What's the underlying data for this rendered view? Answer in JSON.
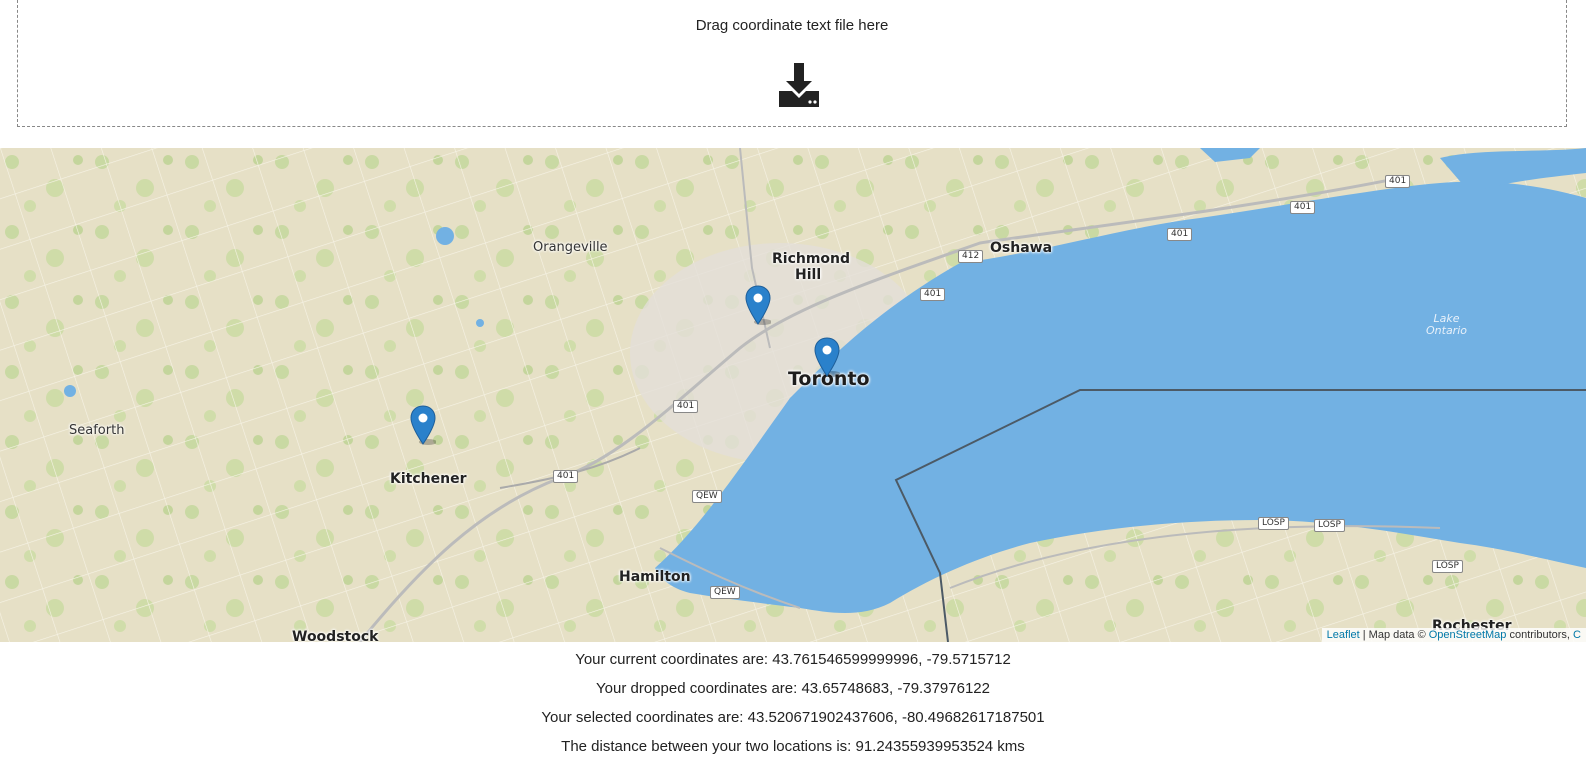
{
  "dropzone": {
    "label": "Drag coordinate text file here",
    "icon": "download-tray-icon"
  },
  "map": {
    "places": {
      "orangeville": "Orangeville",
      "richmond_hill_1": "Richmond",
      "richmond_hill_2": "Hill",
      "oshawa": "Oshawa",
      "toronto": "Toronto",
      "seaforth": "Seaforth",
      "kitchener": "Kitchener",
      "hamilton": "Hamilton",
      "woodstock": "Woodstock",
      "lake_1": "Lake",
      "lake_2": "Ontario",
      "rochester": "Rochester"
    },
    "shields": [
      "401",
      "401",
      "401",
      "412",
      "401",
      "401",
      "401",
      "QEW",
      "QEW",
      "LOSP",
      "LOSP",
      "LOSP"
    ],
    "attribution": {
      "leaflet": "Leaflet",
      "sep": " | Map data © ",
      "osm": "OpenStreetMap",
      "contrib": " contributors, ",
      "cc": "C"
    },
    "colors": {
      "land": "#e6e0c6",
      "water": "#72b1e3",
      "marker": "#2a81cb"
    }
  },
  "info": {
    "current": "Your current coordinates are: 43.761546599999996, -79.5715712",
    "dropped": "Your dropped coordinates are: 43.65748683, -79.37976122",
    "selected": "Your selected coordinates are: 43.520671902437606, -80.49682617187501",
    "distance": "The distance between your two locations is: 91.24355939953524 kms"
  }
}
